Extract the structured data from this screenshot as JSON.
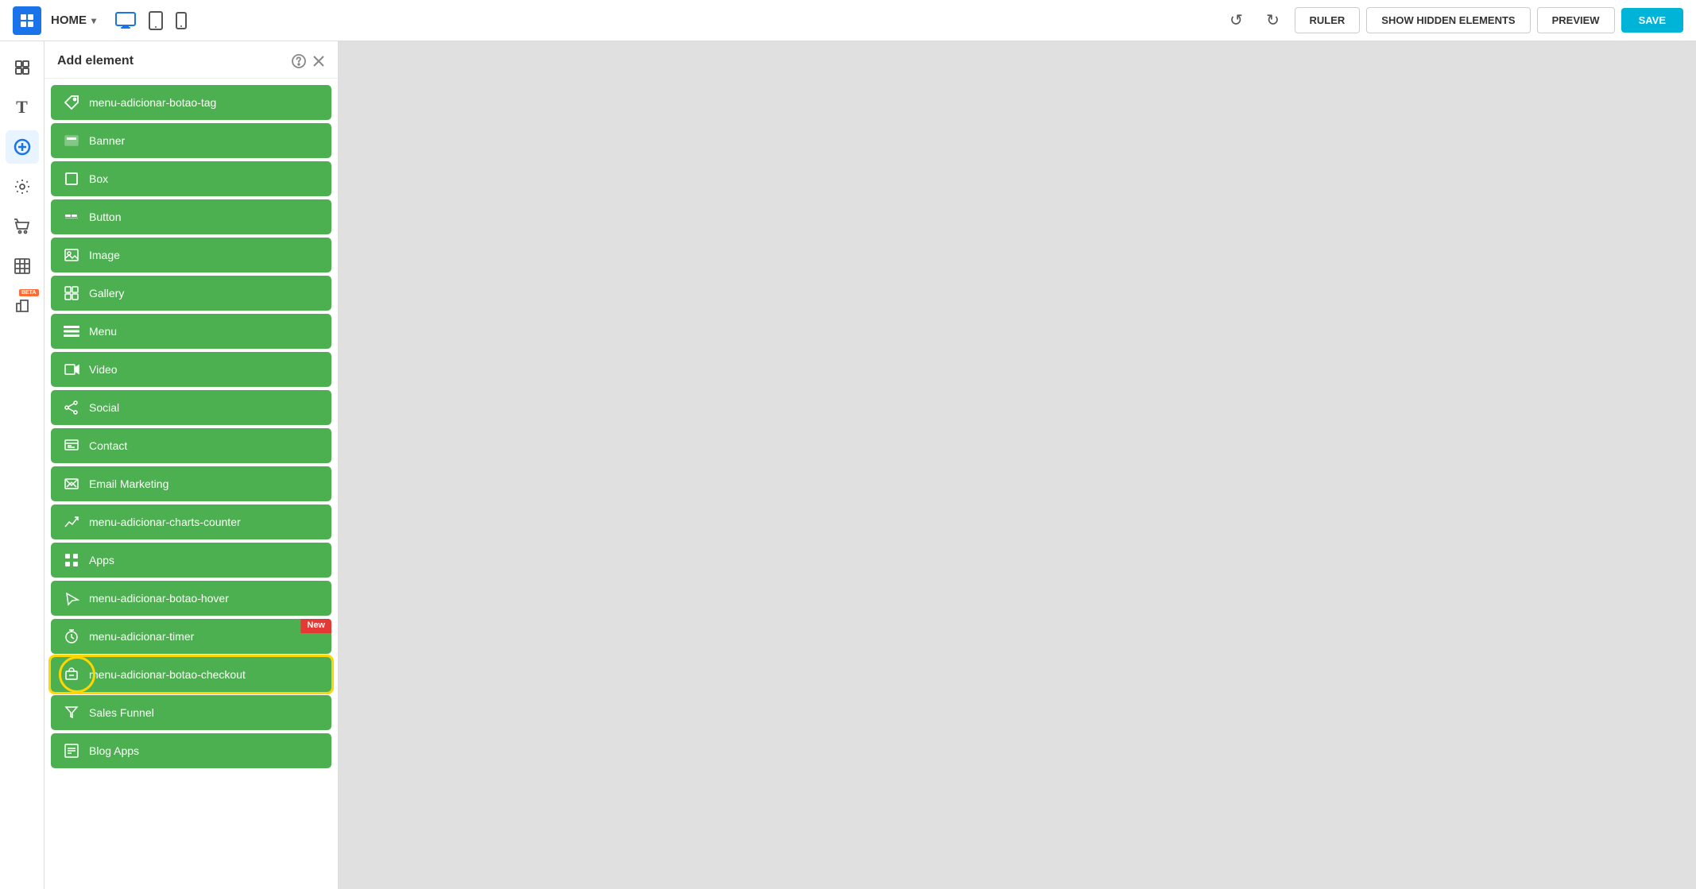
{
  "topbar": {
    "home_label": "HOME",
    "chevron": "▾",
    "undo_label": "↺",
    "redo_label": "↻",
    "ruler_label": "RULER",
    "show_hidden_label": "SHOW HIDDEN ELEMENTS",
    "preview_label": "PREVIEW",
    "save_label": "SAVE"
  },
  "panel": {
    "title": "Add element",
    "help_icon": "?",
    "close_icon": "✕"
  },
  "elements": [
    {
      "id": "menu-adicionar-botao-tag",
      "label": "menu-adicionar-botao-tag",
      "icon": "tag"
    },
    {
      "id": "banner",
      "label": "Banner",
      "icon": "banner"
    },
    {
      "id": "box",
      "label": "Box",
      "icon": "box"
    },
    {
      "id": "button",
      "label": "Button",
      "icon": "button"
    },
    {
      "id": "image",
      "label": "Image",
      "icon": "image"
    },
    {
      "id": "gallery",
      "label": "Gallery",
      "icon": "gallery"
    },
    {
      "id": "menu",
      "label": "Menu",
      "icon": "menu"
    },
    {
      "id": "video",
      "label": "Video",
      "icon": "video"
    },
    {
      "id": "social",
      "label": "Social",
      "icon": "social"
    },
    {
      "id": "contact",
      "label": "Contact",
      "icon": "contact"
    },
    {
      "id": "email-marketing",
      "label": "Email Marketing",
      "icon": "email"
    },
    {
      "id": "menu-adicionar-charts-counter",
      "label": "menu-adicionar-charts-counter",
      "icon": "chart"
    },
    {
      "id": "apps",
      "label": "Apps",
      "icon": "apps"
    },
    {
      "id": "menu-adicionar-botao-hover",
      "label": "menu-adicionar-botao-hover",
      "icon": "hover"
    },
    {
      "id": "menu-adicionar-timer",
      "label": "menu-adicionar-timer",
      "icon": "timer",
      "badge": "New"
    },
    {
      "id": "menu-adicionar-botao-checkout",
      "label": "menu-adicionar-botao-checkout",
      "icon": "checkout",
      "highlighted": true
    },
    {
      "id": "sales-funnel",
      "label": "Sales Funnel",
      "icon": "funnel"
    },
    {
      "id": "blog-apps",
      "label": "Blog Apps",
      "icon": "blog"
    }
  ],
  "sidebar_icons": [
    {
      "id": "layers",
      "icon": "layers",
      "label": "Layers"
    },
    {
      "id": "text",
      "icon": "T",
      "label": "Text"
    },
    {
      "id": "add-element",
      "icon": "+",
      "label": "Add Element",
      "active": true
    },
    {
      "id": "settings",
      "icon": "⚙",
      "label": "Settings"
    },
    {
      "id": "store",
      "icon": "🛍",
      "label": "Store"
    },
    {
      "id": "grid",
      "icon": "grid",
      "label": "Grid"
    },
    {
      "id": "beta-apps",
      "icon": "apps",
      "label": "Beta Apps",
      "beta": true
    }
  ]
}
